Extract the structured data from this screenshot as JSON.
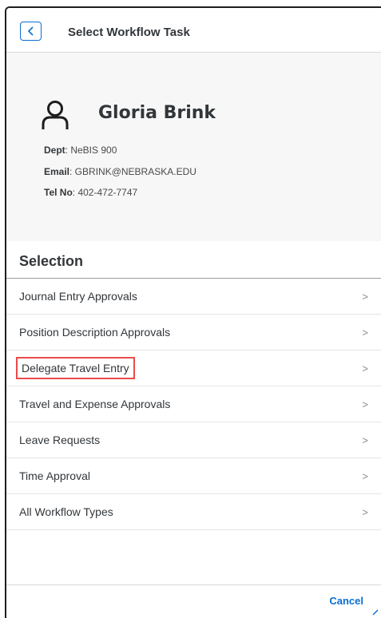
{
  "header": {
    "title": "Select Workflow Task",
    "back_icon": "chevron-left-icon"
  },
  "profile": {
    "icon": "user-icon",
    "name": "Gloria Brink",
    "dept_label": "Dept",
    "dept_value": ": NeBIS 900",
    "email_label": "Email",
    "email_value": ": GBRINK@NEBRASKA.EDU",
    "tel_label": "Tel No",
    "tel_value": ": 402-472-7747"
  },
  "selection": {
    "title": "Selection",
    "items": [
      {
        "label": "Journal Entry Approvals",
        "chevron": ">"
      },
      {
        "label": "Position Description Approvals",
        "chevron": ">"
      },
      {
        "label": "Delegate Travel Entry",
        "chevron": ">"
      },
      {
        "label": "Travel and Expense Approvals",
        "chevron": ">"
      },
      {
        "label": "Leave Requests",
        "chevron": ">"
      },
      {
        "label": "Time Approval",
        "chevron": ">"
      },
      {
        "label": "All Workflow Types",
        "chevron": ">"
      }
    ]
  },
  "footer": {
    "cancel_label": "Cancel"
  },
  "colors": {
    "accent": "#0a6ed1",
    "highlight": "#e94b4b",
    "text": "#32363a"
  }
}
